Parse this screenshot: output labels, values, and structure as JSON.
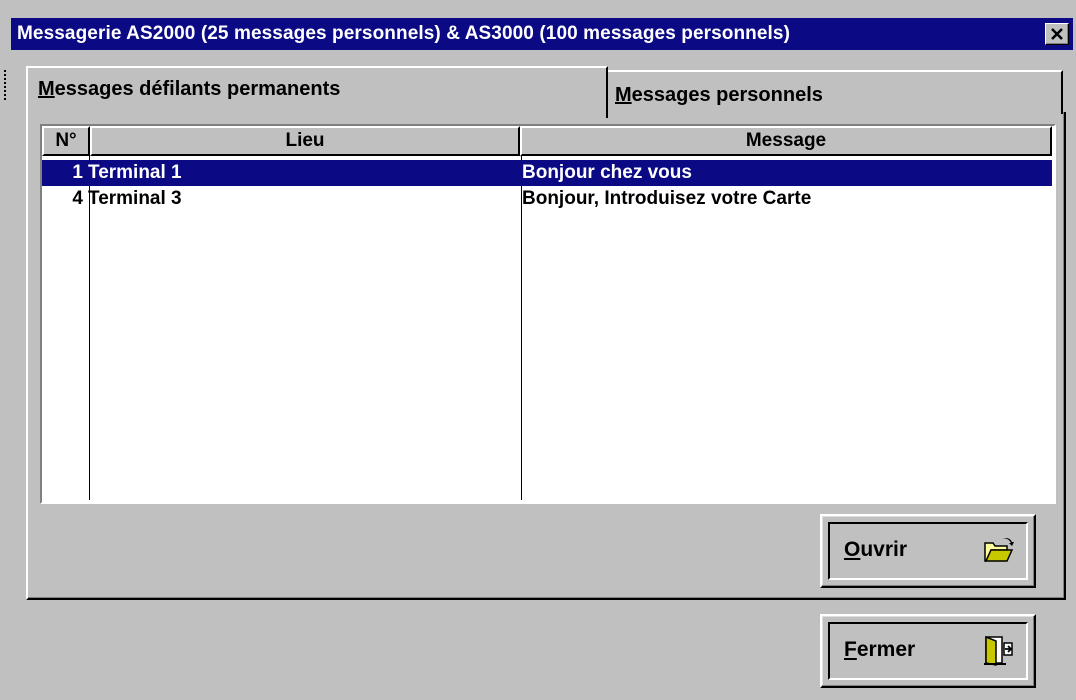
{
  "window": {
    "title": "Messagerie AS2000 (25 messages personnels) & AS3000 (100 messages personnels)",
    "close_symbol": "×"
  },
  "tabs": [
    {
      "label_first": "M",
      "label_rest": "essages défilants permanents",
      "active": true
    },
    {
      "label_first": "M",
      "label_rest": "essages personnels",
      "active": false
    }
  ],
  "table": {
    "columns": {
      "num": "N°",
      "lieu": "Lieu",
      "message": "Message"
    },
    "rows": [
      {
        "num": "1",
        "lieu": "Terminal 1",
        "message": "Bonjour chez vous",
        "selected": true
      },
      {
        "num": "4",
        "lieu": "Terminal 3",
        "message": "Bonjour, Introduisez votre Carte",
        "selected": false
      }
    ]
  },
  "buttons": {
    "open": {
      "first": "O",
      "rest": "uvrir",
      "icon": "folder-open-icon"
    },
    "close": {
      "first": "F",
      "rest": "ermer",
      "icon": "door-exit-icon"
    }
  },
  "colors": {
    "title_bar": "#0b0a84",
    "selection": "#0b0a84",
    "face": "#c0c0c0"
  }
}
